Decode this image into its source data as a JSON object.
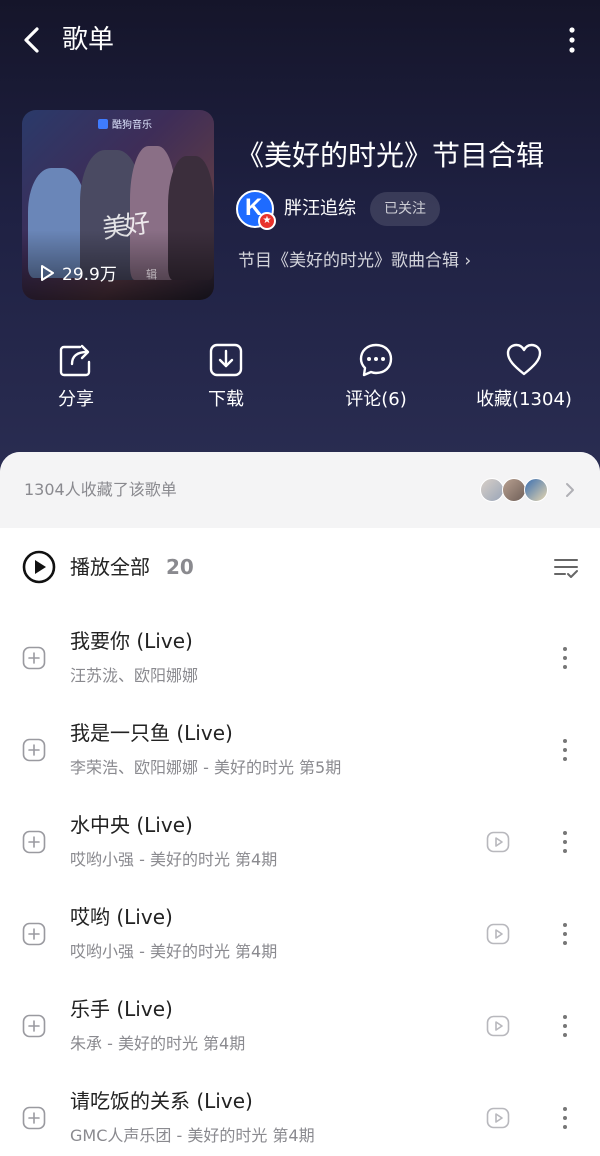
{
  "header": {
    "back_icon": "chevron-left-icon",
    "title": "歌单",
    "more_icon": "more-vertical-icon"
  },
  "playlist": {
    "cover": {
      "brand": "酷狗音乐",
      "play_count": "29.9万",
      "tag": "辑"
    },
    "title": "《美好的时光》节目合辑",
    "creator": {
      "avatar_letter": "K",
      "name": "胖汪追综",
      "follow_label": "已关注"
    },
    "description": "节目《美好的时光》歌曲合辑 ›"
  },
  "actions": [
    {
      "icon": "share-icon",
      "label": "分享"
    },
    {
      "icon": "download-icon",
      "label": "下载"
    },
    {
      "icon": "comment-icon",
      "label": "评论(6)"
    },
    {
      "icon": "heart-icon",
      "label": "收藏(1304)"
    }
  ],
  "favorites_bar": {
    "text": "1304人收藏了该歌单",
    "chevron_icon": "chevron-right-icon"
  },
  "play_all": {
    "label": "播放全部",
    "count": "20",
    "manage_icon": "list-manage-icon"
  },
  "songs": [
    {
      "name": "我要你 (Live)",
      "subtitle": "汪苏泷、欧阳娜娜",
      "has_mv": false
    },
    {
      "name": "我是一只鱼 (Live)",
      "subtitle": "李荣浩、欧阳娜娜 - 美好的时光 第5期",
      "has_mv": false
    },
    {
      "name": "水中央 (Live)",
      "subtitle": "哎哟小强 - 美好的时光 第4期",
      "has_mv": true
    },
    {
      "name": "哎哟 (Live)",
      "subtitle": "哎哟小强 - 美好的时光 第4期",
      "has_mv": true
    },
    {
      "name": "乐手 (Live)",
      "subtitle": "朱承 - 美好的时光 第4期",
      "has_mv": true
    },
    {
      "name": "请吃饭的关系 (Live)",
      "subtitle": "GMC人声乐团 - 美好的时光 第4期",
      "has_mv": true
    }
  ],
  "colors": {
    "hero_bg": "#1f2143",
    "sheet_bg": "#ffffff",
    "muted_text": "#8a8a8f",
    "creator_blue": "#1e6bff",
    "badge_red": "#e8322b"
  }
}
